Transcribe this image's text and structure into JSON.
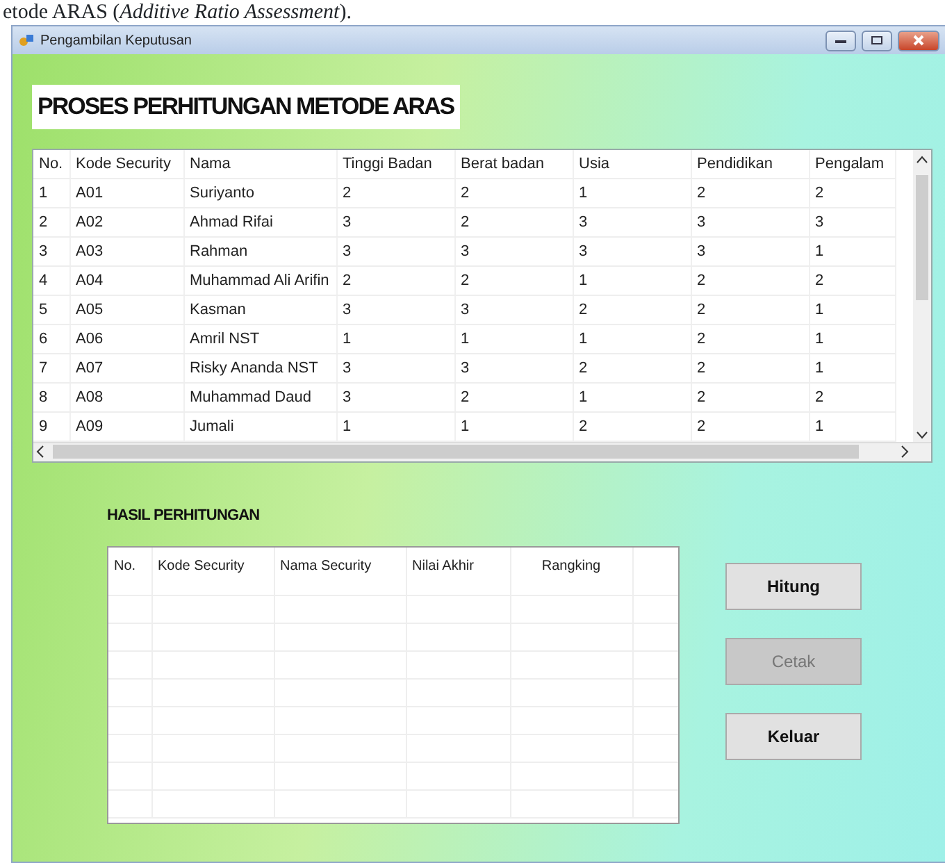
{
  "document_caption": "etode ARAS (*Additive Ratio Assessment*).",
  "window": {
    "title": "Pengambilan Keputusan"
  },
  "heading": "PROSES PERHITUNGAN METODE ARAS",
  "criteria_table": {
    "columns": [
      "No.",
      "Kode Security",
      "Nama",
      "Tinggi Badan",
      "Berat badan",
      "Usia",
      "Pendidikan",
      "Pengalam"
    ],
    "rows": [
      [
        "1",
        "A01",
        "Suriyanto",
        "2",
        "2",
        "1",
        "2",
        "2"
      ],
      [
        "2",
        "A02",
        "Ahmad Rifai",
        "3",
        "2",
        "3",
        "3",
        "3"
      ],
      [
        "3",
        "A03",
        "Rahman",
        "3",
        "3",
        "3",
        "3",
        "1"
      ],
      [
        "4",
        "A04",
        "Muhammad Ali Arifin",
        "2",
        "2",
        "1",
        "2",
        "2"
      ],
      [
        "5",
        "A05",
        "Kasman",
        "3",
        "3",
        "2",
        "2",
        "1"
      ],
      [
        "6",
        "A06",
        "Amril NST",
        "1",
        "1",
        "1",
        "2",
        "1"
      ],
      [
        "7",
        "A07",
        "Risky Ananda NST",
        "3",
        "3",
        "2",
        "2",
        "1"
      ],
      [
        "8",
        "A08",
        "Muhammad Daud",
        "3",
        "2",
        "1",
        "2",
        "2"
      ],
      [
        "9",
        "A09",
        "Jumali",
        "1",
        "1",
        "2",
        "2",
        "1"
      ]
    ]
  },
  "result_section": {
    "label": "HASIL PERHITUNGAN",
    "columns": [
      "No.",
      "Kode Security",
      "Nama Security",
      "Nilai Akhir",
      "Rangking"
    ]
  },
  "buttons": [
    {
      "label": "Hitung",
      "disabled": false
    },
    {
      "label": "Cetak",
      "disabled": true
    },
    {
      "label": "Keluar",
      "disabled": false
    }
  ]
}
